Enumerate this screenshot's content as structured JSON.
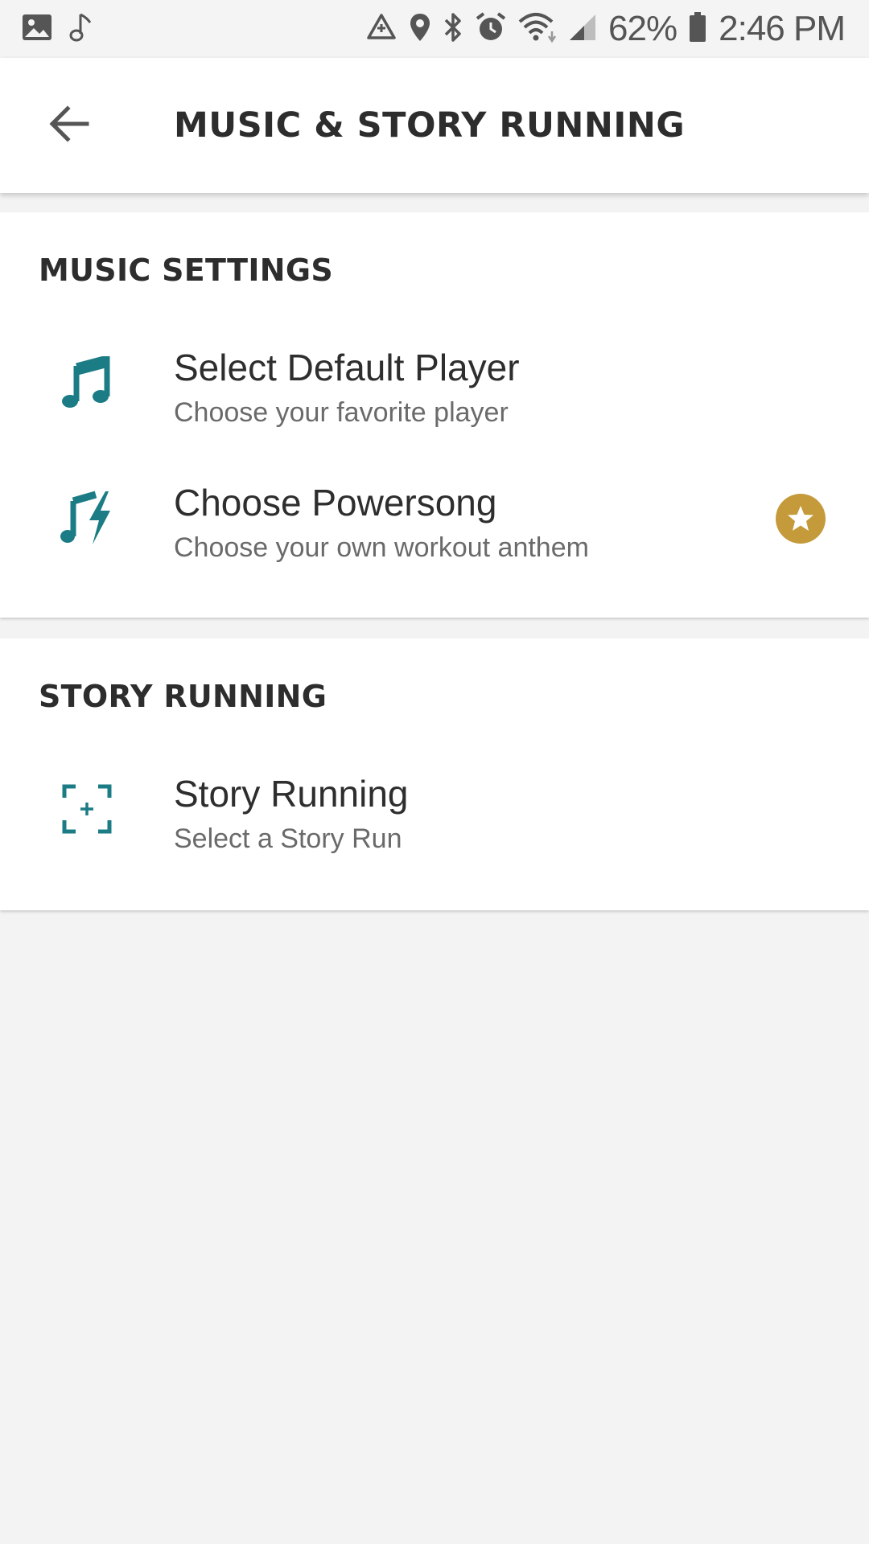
{
  "status_bar": {
    "battery_percent": "62%",
    "time": "2:46 PM",
    "left_icons": [
      "image-icon",
      "music-note-icon"
    ],
    "right_icons": [
      "recycle-icon",
      "location-pin-icon",
      "bluetooth-icon",
      "alarm-icon",
      "wifi-icon",
      "signal-icon",
      "battery-icon"
    ]
  },
  "header": {
    "title": "MUSIC & STORY RUNNING",
    "back_icon": "arrow-back-icon"
  },
  "sections": [
    {
      "header": "MUSIC SETTINGS",
      "items": [
        {
          "title": "Select Default Player",
          "subtitle": "Choose your favorite player",
          "icon": "music-note-icon"
        },
        {
          "title": "Choose Powersong",
          "subtitle": "Choose your own workout anthem",
          "icon": "powersong-icon",
          "badge": "star-badge-icon"
        }
      ]
    },
    {
      "header": "STORY RUNNING",
      "items": [
        {
          "title": "Story Running",
          "subtitle": "Select a Story Run",
          "icon": "add-frame-icon"
        }
      ]
    }
  ],
  "colors": {
    "accent_teal": "#1b7c85",
    "badge_gold": "#c49a3b",
    "background": "#f3f3f3",
    "card": "#ffffff"
  }
}
